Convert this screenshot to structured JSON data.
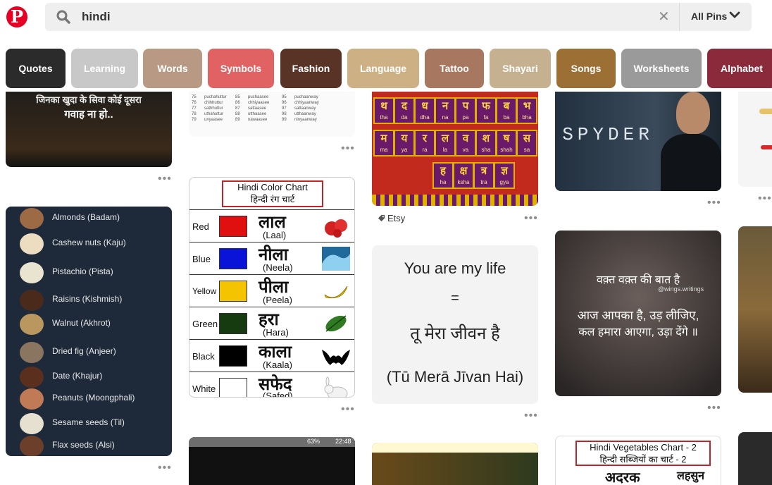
{
  "header": {
    "logo_letter": "P",
    "search_query": "hindi",
    "clear_icon": "close-icon",
    "scope_label": "All Pins"
  },
  "chips": [
    {
      "label": "Quotes",
      "color": "#2b2b2b"
    },
    {
      "label": "Learning",
      "color": "#c8c8c8"
    },
    {
      "label": "Words",
      "color": "#b89a84"
    },
    {
      "label": "Symbols",
      "color": "#e06262"
    },
    {
      "label": "Fashion",
      "color": "#5a3327"
    },
    {
      "label": "Language",
      "color": "#cdb184"
    },
    {
      "label": "Tattoo",
      "color": "#a8775f"
    },
    {
      "label": "Shayari",
      "color": "#c5b190"
    },
    {
      "label": "Songs",
      "color": "#9c7034"
    },
    {
      "label": "Worksheets",
      "color": "#9a9a9a"
    },
    {
      "label": "Alphabet",
      "color": "#8a2a3a"
    }
  ],
  "pins": {
    "quote_top": {
      "line1": "जिनका खुदा के सिवा कोई दूसरा",
      "line2": "गवाह ना हो.."
    },
    "numbers_table": {
      "rows": [
        [
          "75",
          "puchahuttur",
          "85",
          "puchaasee",
          "95",
          "puchaanway"
        ],
        [
          "76",
          "chihhuttur",
          "86",
          "chhiyaasee",
          "96",
          "chhiyaanway"
        ],
        [
          "77",
          "sathhuttur",
          "87",
          "sattaasee",
          "97",
          "sattaanway"
        ],
        [
          "78",
          "uthahuttur",
          "88",
          "utthaasee",
          "98",
          "utthaanway"
        ],
        [
          "79",
          "unyaasee",
          "89",
          "nawaasee",
          "99",
          "ninyaanway"
        ]
      ]
    },
    "alphabet_chart": {
      "rows": [
        [
          [
            "थ",
            "tha"
          ],
          [
            "द",
            "da"
          ],
          [
            "ध",
            "dha"
          ],
          [
            "न",
            "na"
          ],
          [
            "प",
            "pa"
          ],
          [
            "फ",
            "fa"
          ],
          [
            "ब",
            "ba"
          ],
          [
            "भ",
            "bha"
          ]
        ],
        [
          [
            "म",
            "ma"
          ],
          [
            "य",
            "ya"
          ],
          [
            "र",
            "ra"
          ],
          [
            "ल",
            "la"
          ],
          [
            "व",
            "va"
          ],
          [
            "श",
            "sha"
          ],
          [
            "ष",
            "shah"
          ],
          [
            "स",
            "sa"
          ]
        ],
        [
          [
            "ह",
            "ha"
          ],
          [
            "क्ष",
            "ksha"
          ],
          [
            "त्र",
            "tra"
          ],
          [
            "ज्ञ",
            "gya"
          ]
        ]
      ],
      "source_tag": "Etsy"
    },
    "movie_poster": {
      "title": "SPYDER"
    },
    "dry_fruits": [
      {
        "label": "Almonds (Badam)",
        "color": "#9c6a45"
      },
      {
        "label": "Cashew nuts (Kaju)",
        "color": "#ecdcc0"
      },
      {
        "label": "Pistachio (Pista)",
        "color": "#e8e4cf"
      },
      {
        "label": "Raisins (Kishmish)",
        "color": "#4a2a1a"
      },
      {
        "label": "Walnut (Akhrot)",
        "color": "#b9975e"
      },
      {
        "label": "Dried fig (Anjeer)",
        "color": "#8a7560"
      },
      {
        "label": "Date (Khajur)",
        "color": "#5a2f1e"
      },
      {
        "label": "Peanuts (Moongphali)",
        "color": "#c07a55"
      },
      {
        "label": "Sesame seeds (Til)",
        "color": "#e5e0d0"
      },
      {
        "label": "Flax seeds (Alsi)",
        "color": "#6b3f2a"
      }
    ],
    "color_chart": {
      "title_en": "Hindi Color Chart",
      "title_hi": "हिन्दी रंग चार्ट",
      "rows": [
        {
          "name": "Red",
          "hindi": "लाल",
          "roman": "(Laal)",
          "swatch": "#e01010"
        },
        {
          "name": "Blue",
          "hindi": "नीला",
          "roman": "(Neela)",
          "swatch": "#0a14d8"
        },
        {
          "name": "Yellow",
          "hindi": "पीला",
          "roman": "(Peela)",
          "swatch": "#f4c400"
        },
        {
          "name": "Green",
          "hindi": "हरा",
          "roman": "(Hara)",
          "swatch": "#173b11"
        },
        {
          "name": "Black",
          "hindi": "काला",
          "roman": "(Kaala)",
          "swatch": "#000000"
        },
        {
          "name": "White",
          "hindi": "सफेद",
          "roman": "(Safed)",
          "swatch": "#ffffff"
        }
      ]
    },
    "life_quote": {
      "line1": "You are my life",
      "line2": "=",
      "line3": "तू मेरा जीवन है",
      "line4": "(Tū Merā Jīvan Hai)"
    },
    "waqt_quote": {
      "line1": "वक़्त वक़्त की बात है",
      "handle": "@wings.writings",
      "line2": "आज आपका है, उड़ लीजिए,",
      "line3": "कल हमारा आएगा, उड़ा देंगे ॥"
    },
    "phone_status": {
      "battery": "63%",
      "time": "22:48"
    },
    "vegetables_chart": {
      "title_en": "Hindi Vegetables Chart - 2",
      "title_hi": "हिन्दी सब्जियों का चार्ट - 2",
      "word1": "अदरक",
      "word2": "लहसुन"
    },
    "more_icon": "ellipsis-icon"
  }
}
